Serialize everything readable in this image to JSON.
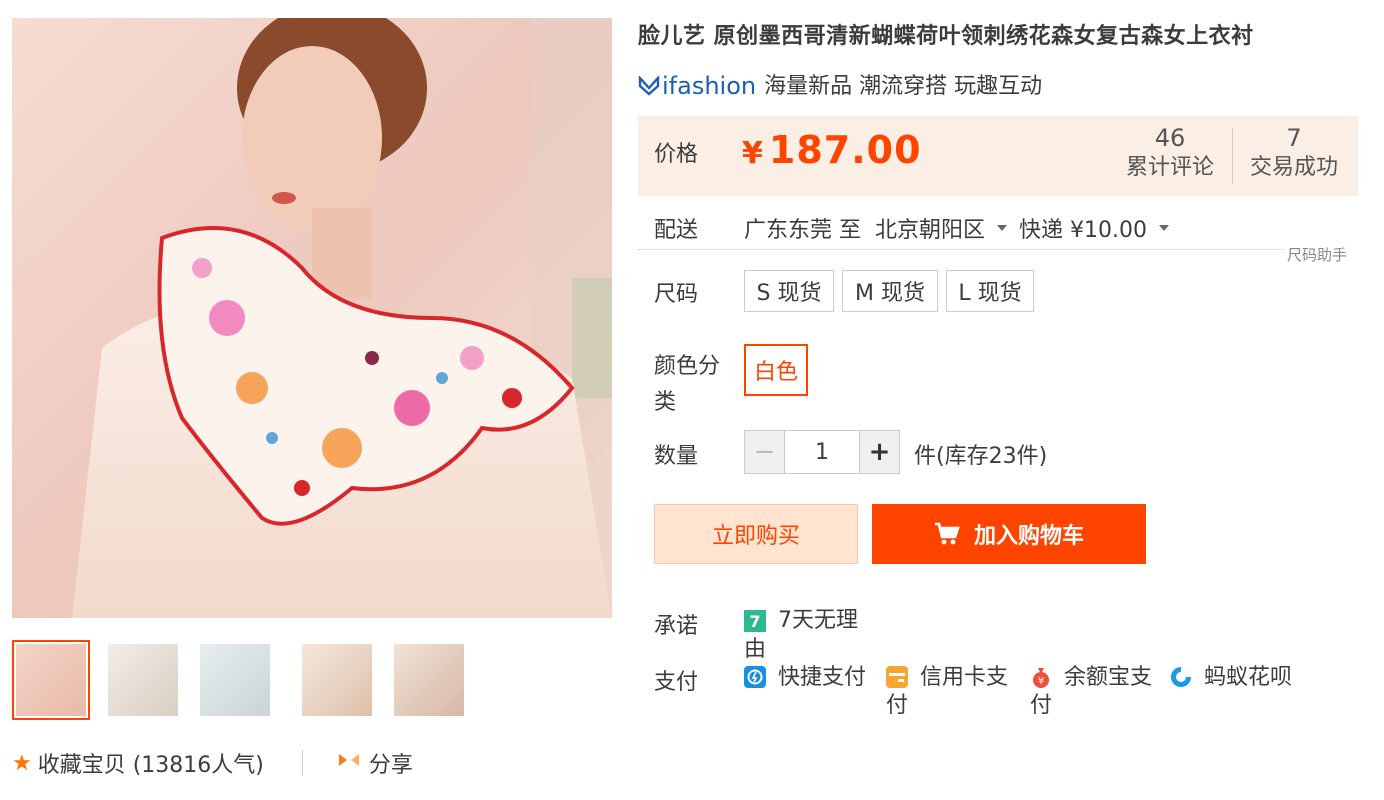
{
  "product": {
    "title": "脸儿艺 原创墨西哥清新蝴蝶荷叶领刺绣花森女复古森女上衣衬"
  },
  "brand": {
    "logo_text": "ifashion",
    "slogan": "海量新品 潮流穿搭 玩趣互动",
    "logo_color": "#1e5fb4"
  },
  "price": {
    "label": "价格",
    "currency": "¥",
    "value": "187.00",
    "color": "#ff4400",
    "reviews_count": "46",
    "reviews_label": "累计评论",
    "sales_count": "7",
    "sales_label": "交易成功"
  },
  "shipping": {
    "label": "配送",
    "from": "广东东莞 至",
    "to": "北京朝阳区",
    "method": "快递 ¥10.00",
    "size_helper": "尺码助手"
  },
  "size": {
    "label": "尺码",
    "options": [
      "S 现货",
      "M 现货",
      "L 现货"
    ]
  },
  "color": {
    "label_line1": "颜色分",
    "label_line2": "类",
    "selected": "白色"
  },
  "quantity": {
    "label": "数量",
    "value": "1",
    "minus": "−",
    "plus": "+",
    "stock_text": "件(库存23件)"
  },
  "actions": {
    "buy_now": "立即购买",
    "add_to_cart": "加入购物车"
  },
  "promise": {
    "label": "承诺",
    "icon_text": "7",
    "text_line1": "7天无理",
    "text_line2": "由"
  },
  "payment": {
    "label": "支付",
    "methods": [
      {
        "line1": "快捷支付",
        "line2": ""
      },
      {
        "line1": "信用卡支",
        "line2": "付"
      },
      {
        "line1": "余额宝支",
        "line2": "付"
      },
      {
        "line1": "蚂蚁花呗",
        "line2": ""
      }
    ]
  },
  "gallery": {
    "thumb_count": 5,
    "active_index": 0
  },
  "social": {
    "favorite": "收藏宝贝 (13816人气)",
    "share": "分享"
  },
  "icons": {
    "star": "star-icon",
    "share": "share-icon",
    "cart": "cart-icon",
    "caret": "chevron-down-icon"
  }
}
